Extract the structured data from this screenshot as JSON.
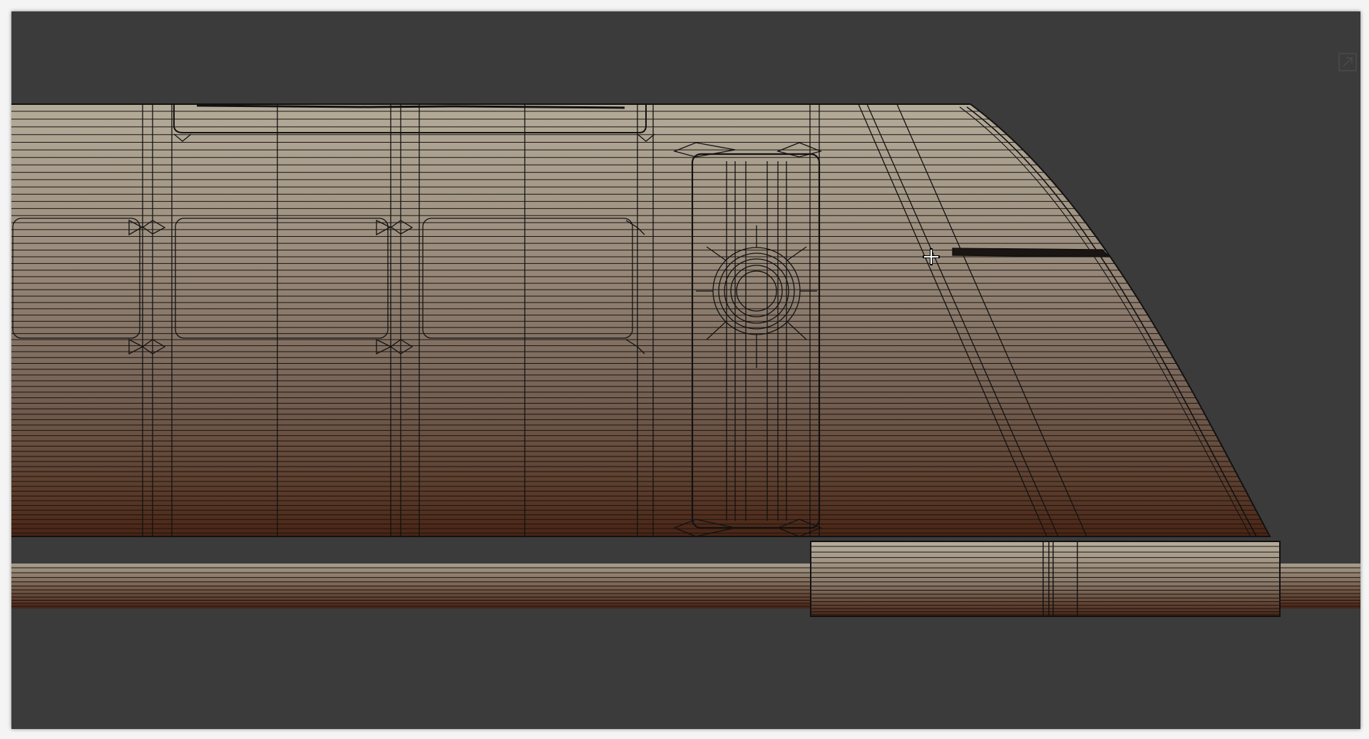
{
  "viewport": {
    "background_color": "#3b3b3b",
    "shading": "solid-wireframe",
    "mesh_gradient": [
      "#b4ab99",
      "#9a8c7c",
      "#776457",
      "#5c3e2d",
      "#4a2414"
    ],
    "wire_color": "#1a1412",
    "cursor": "move-cursor",
    "controls": {
      "maximize_icon": "maximize-icon"
    }
  }
}
